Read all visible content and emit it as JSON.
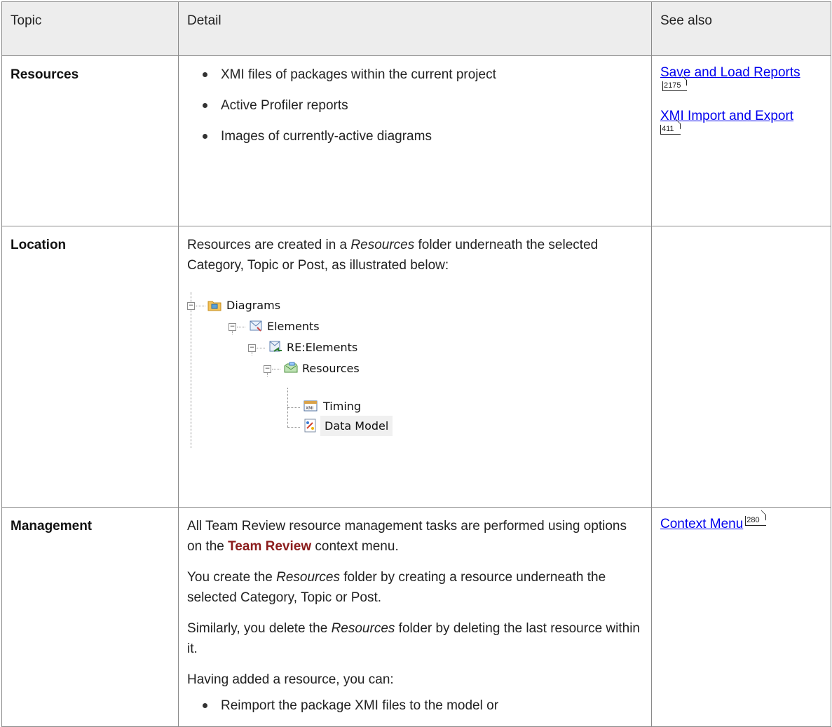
{
  "headers": {
    "topic": "Topic",
    "detail": "Detail",
    "see_also": "See also"
  },
  "rows": [
    {
      "topic": "Resources",
      "bullets": [
        "XMI files of packages within the current project",
        "Active Profiler reports",
        "Images of currently-active diagrams"
      ],
      "see_also": [
        {
          "label": "Save and Load Reports",
          "page": "2175"
        },
        {
          "label": "XMI Import and Export",
          "page": "411"
        }
      ]
    },
    {
      "topic": "Location",
      "detail_before": "Resources are created in a ",
      "detail_em": "Resources",
      "detail_after": " folder underneath the selected Category, Topic or Post, as illustrated below:",
      "tree": [
        {
          "label": "Diagrams",
          "icon": "category-folder-icon"
        },
        {
          "label": "Elements",
          "icon": "topic-icon"
        },
        {
          "label": "RE:Elements",
          "icon": "post-reply-icon"
        },
        {
          "label": "Resources",
          "icon": "resources-folder-icon"
        },
        {
          "label": "Timing",
          "icon": "xmi-file-icon"
        },
        {
          "label": "Data Model",
          "icon": "diagram-icon"
        }
      ]
    },
    {
      "topic": "Management",
      "p1_before": "All Team Review resource management tasks are performed using options on the ",
      "p1_strong": "Team Review",
      "p1_after": " context menu.",
      "p2_before": "You create the ",
      "p2_em": "Resources",
      "p2_after": " folder by creating a resource underneath the selected Category, Topic or Post.",
      "p3_before": "Similarly, you delete the ",
      "p3_em": "Resources",
      "p3_after": " folder by deleting the last resource within it.",
      "p4": "Having added a resource, you can:",
      "bullets": [
        "Reimport the package XMI files to the model or"
      ],
      "see_also": [
        {
          "label": "Context Menu",
          "page": "280"
        }
      ]
    }
  ]
}
